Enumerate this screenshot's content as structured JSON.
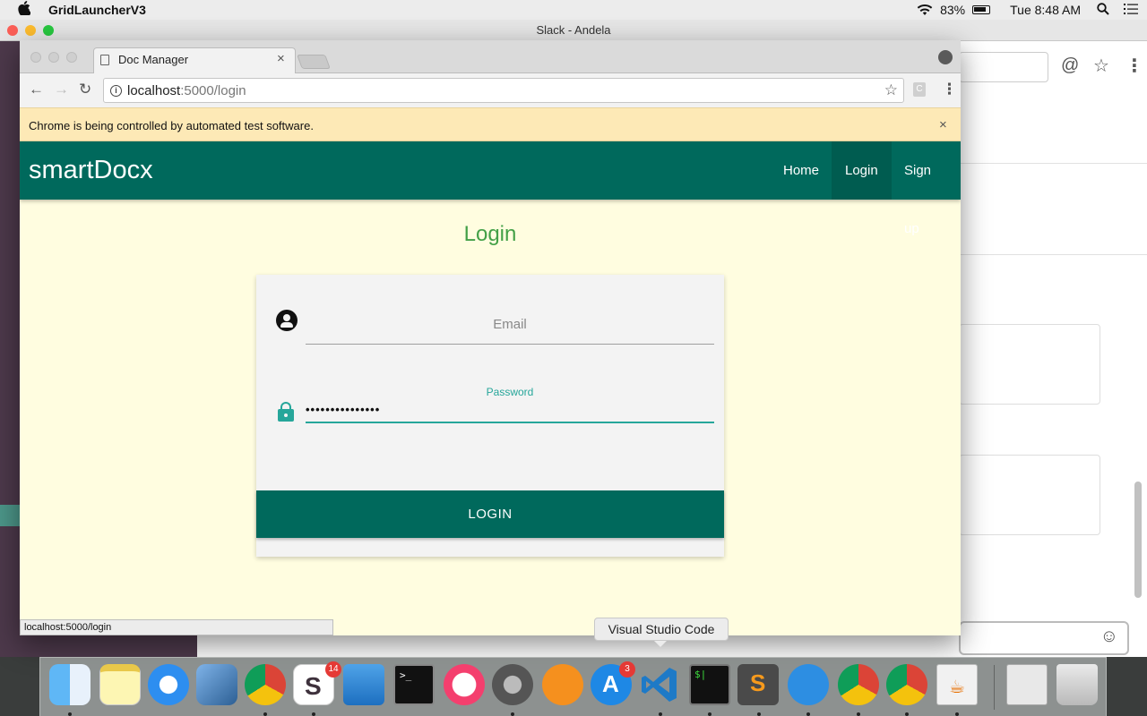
{
  "menubar": {
    "apple": "",
    "app_name": "GridLauncherV3",
    "battery": "83%",
    "clock": "Tue 8:48 AM"
  },
  "slack": {
    "window_title": "Slack - Andela",
    "icons": {
      "at": "@",
      "star": "☆",
      "kebab": "⋮",
      "emoji": "☺"
    }
  },
  "browser": {
    "tab_title": "Doc Manager",
    "tab_close": "×",
    "url_host": "localhost",
    "url_path": ":5000/login",
    "ext_label": "C",
    "infobar_text": "Chrome is being controlled by automated test software.",
    "infobar_close": "×",
    "status_url": "localhost:5000/login",
    "nav": {
      "back": "←",
      "forward": "→",
      "reload": "↻",
      "star": "☆",
      "kebab": "⋮"
    }
  },
  "app": {
    "brand": "smartDocx",
    "nav": [
      {
        "label": "Home"
      },
      {
        "label": "Login"
      },
      {
        "label": "Sign up"
      }
    ],
    "active_nav": "Login",
    "page_title": "Login",
    "email_placeholder": "Email",
    "password_label": "Password",
    "password_value": "•••••••••••••••",
    "login_button": "LOGIN"
  },
  "dock": {
    "tooltip": "Visual Studio Code",
    "badges": {
      "slack": "14",
      "appstore": "3"
    },
    "items": [
      "finder-icon",
      "notes-icon",
      "safari-icon",
      "mail-icon",
      "chrome-icon",
      "slack-icon",
      "keynote-icon",
      "terminal-icon",
      "itunes-icon",
      "system-preferences-icon",
      "ibooks-icon",
      "app-store-icon",
      "vscode-icon",
      "terminal-green-icon",
      "sublime-text-icon",
      "postgres-icon",
      "chrome-icon-2",
      "chrome-icon-3",
      "java-icon",
      "preview-icon",
      "trash-icon"
    ]
  },
  "colors": {
    "navbar": "#00695c",
    "page_bg": "#fffde0",
    "title_green": "#43a047",
    "accent_teal": "#26a69a",
    "infobar": "#fde9b6"
  }
}
